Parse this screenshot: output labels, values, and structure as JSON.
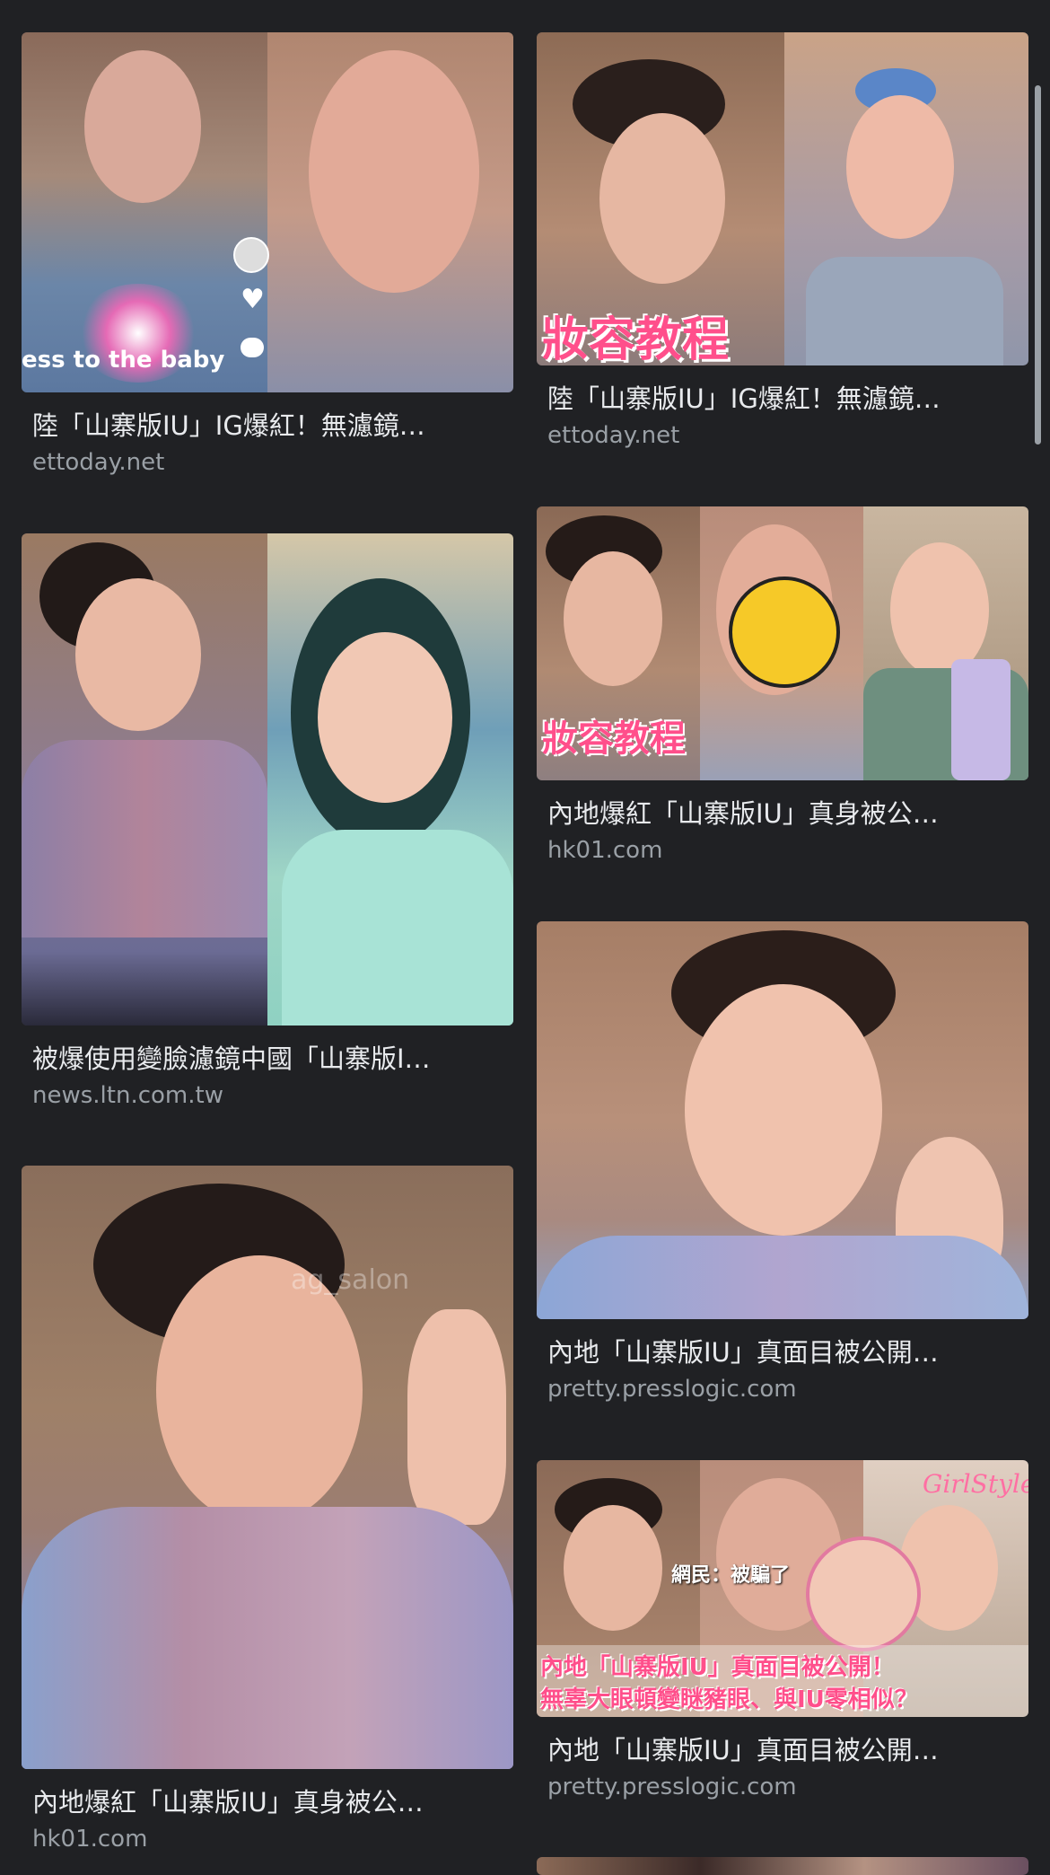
{
  "results": [
    {
      "title": "陸「山寨版IU」IG爆紅！無濾鏡…",
      "source": "ettoday.net",
      "image_caption": "",
      "tiktok_overlay": "ess to the baby"
    },
    {
      "title": "陸「山寨版IU」IG爆紅！無濾鏡…",
      "source": "ettoday.net",
      "image_caption": "妝容教程"
    },
    {
      "title": "被爆使用變臉濾鏡中國「山寨版I…",
      "source": "news.ltn.com.tw",
      "image_caption": ""
    },
    {
      "title": "內地爆紅「山寨版IU」真身被公…",
      "source": "hk01.com",
      "image_caption": "妝容教程"
    },
    {
      "title": "內地「山寨版IU」真面目被公開…",
      "source": "pretty.presslogic.com",
      "image_caption": ""
    },
    {
      "title": "內地爆紅「山寨版IU」真身被公…",
      "source": "hk01.com",
      "image_caption": "",
      "watermark": "ag_salon"
    },
    {
      "title": "內地「山寨版IU」真面目被公開…",
      "source": "pretty.presslogic.com",
      "image_caption": "內地「山寨版IU」真面目被公開！",
      "image_caption_2": "無辜大眼頓變瞇豬眼、與IU零相似？",
      "image_bubble": "網民：被騙了",
      "brand_logo": "GirlStyle"
    }
  ],
  "colors": {
    "background": "#202124",
    "title_text": "#e8eaed",
    "source_text": "#9aa0a6"
  }
}
